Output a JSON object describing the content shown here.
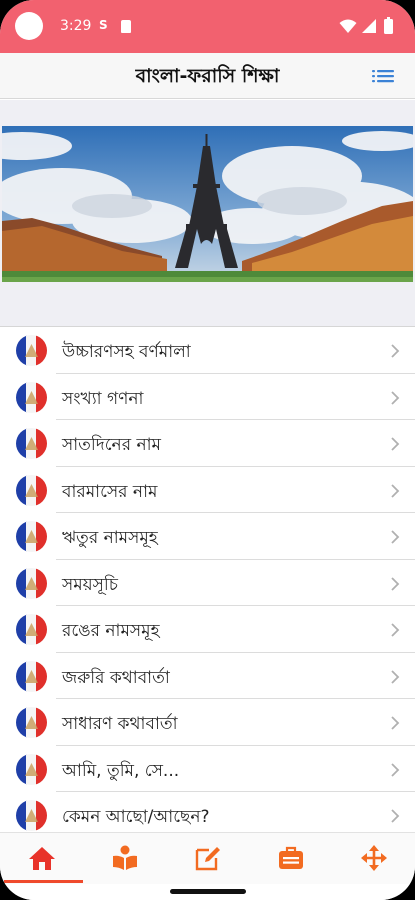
{
  "status": {
    "time": "3:29",
    "indicator": "S"
  },
  "header": {
    "title": "বাংলা-ফরাসি শিক্ষা",
    "menu_icon": "list-menu-icon"
  },
  "lessons": [
    {
      "label": "উচ্চারণসহ বর্ণমালা"
    },
    {
      "label": "সংখ্যা গণনা"
    },
    {
      "label": "সাতদিনের নাম"
    },
    {
      "label": "বারমাসের নাম"
    },
    {
      "label": "ঋতুর নামসমূহ"
    },
    {
      "label": "সময়সূচি"
    },
    {
      "label": "রঙের নামসমূহ"
    },
    {
      "label": "জরুরি কথাবার্তা"
    },
    {
      "label": "সাধারণ কথাবার্তা"
    },
    {
      "label": "আমি, তুমি, সে..."
    },
    {
      "label": "কেমন আছো/আছেন?"
    }
  ],
  "tabs": [
    {
      "icon": "home-icon",
      "active": true
    },
    {
      "icon": "book-reader-icon",
      "active": false
    },
    {
      "icon": "edit-icon",
      "active": false
    },
    {
      "icon": "toolbox-icon",
      "active": false
    },
    {
      "icon": "move-arrows-icon",
      "active": false
    }
  ],
  "colors": {
    "status_bar": "#f2616f",
    "tab_icon": "#f26b21",
    "active_tab_icon": "#e8332a",
    "menu_icon": "#3b82d6"
  }
}
